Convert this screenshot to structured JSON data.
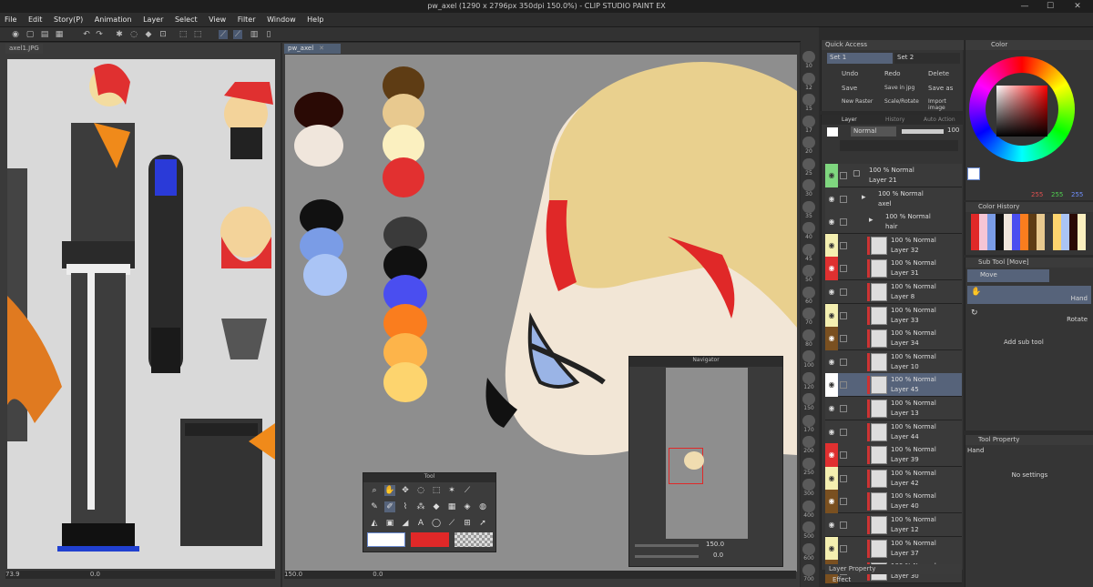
{
  "window": {
    "title": "pw_axel (1290 x 2796px 350dpi 150.0%) - CLIP STUDIO PAINT EX",
    "min": "—",
    "max": "☐",
    "close": "✕"
  },
  "menu": [
    "File",
    "Edit",
    "Story(P)",
    "Animation",
    "Layer",
    "Select",
    "View",
    "Filter",
    "Window",
    "Help"
  ],
  "left_doc": {
    "tab": "axel1.JPG",
    "zoom": "73.9",
    "rotation": "0.0"
  },
  "main_doc": {
    "tab": "pw_axel",
    "zoom": "150.0",
    "rotation": "0.0"
  },
  "navigator": {
    "title": "Navigator",
    "zoom": "150.0",
    "rotation": "0.0"
  },
  "tool_panel": {
    "title": "Tool"
  },
  "palette_levels": [
    "10",
    "12",
    "15",
    "17",
    "20",
    "25",
    "30",
    "35",
    "40",
    "45",
    "50",
    "60",
    "70",
    "80",
    "100",
    "120",
    "150",
    "170",
    "200",
    "250",
    "300",
    "400",
    "500",
    "600",
    "700"
  ],
  "quick_access": {
    "title": "Quick Access",
    "set1": "Set 1",
    "set2": "Set 2",
    "buttons": [
      "Undo",
      "Redo",
      "Delete",
      "Save",
      "Save in jpg",
      "Save as",
      "New Raster",
      "Scale/Rotate",
      "Import image"
    ]
  },
  "layer_panel": {
    "tabs": [
      "Layer",
      "History",
      "Auto Action"
    ],
    "blend_mode": "Normal",
    "opacity": "100",
    "layers": [
      {
        "pct": "100 % Normal",
        "name": "Layer 21",
        "color": "#7fd67f"
      },
      {
        "pct": "100 % Normal",
        "name": "axel",
        "color": ""
      },
      {
        "pct": "100 % Normal",
        "name": "hair",
        "color": ""
      },
      {
        "pct": "100 % Normal",
        "name": "Layer 32",
        "color": "#f4efb0"
      },
      {
        "pct": "100 % Normal",
        "name": "Layer 31",
        "color": "#e03030"
      },
      {
        "pct": "100 % Normal",
        "name": "Layer 8",
        "color": ""
      },
      {
        "pct": "100 % Normal",
        "name": "Layer 33",
        "color": "#f4efb0"
      },
      {
        "pct": "100 % Normal",
        "name": "Layer 34",
        "color": "#7a5020"
      },
      {
        "pct": "100 % Normal",
        "name": "Layer 10",
        "color": ""
      },
      {
        "pct": "100 % Normal",
        "name": "Layer 45",
        "color": "#ffffff"
      },
      {
        "pct": "100 % Normal",
        "name": "Layer 13",
        "color": ""
      },
      {
        "pct": "100 % Normal",
        "name": "Layer 44",
        "color": ""
      },
      {
        "pct": "100 % Normal",
        "name": "Layer 39",
        "color": "#e03030"
      },
      {
        "pct": "100 % Normal",
        "name": "Layer 42",
        "color": "#f4efb0"
      },
      {
        "pct": "100 % Normal",
        "name": "Layer 40",
        "color": "#7a5020"
      },
      {
        "pct": "100 % Normal",
        "name": "Layer 12",
        "color": ""
      },
      {
        "pct": "100 % Normal",
        "name": "Layer 37",
        "color": "#f4efb0"
      },
      {
        "pct": "100 % Normal",
        "name": "Layer 30",
        "color": "#7a5020"
      }
    ]
  },
  "layer_property": {
    "title": "Layer Property",
    "effect": "Effect"
  },
  "color_panel": {
    "title": "Color",
    "r": "255",
    "g": "255",
    "b": "255",
    "history_title": "Color History"
  },
  "subtool": {
    "title": "Sub Tool [Move]",
    "group": "Move",
    "items": [
      "Hand",
      "Rotate"
    ],
    "add": "Add sub tool"
  },
  "tool_property": {
    "title": "Tool Property",
    "tool": "Hand",
    "empty": "No settings"
  },
  "swatches": {
    "col1": [
      "#2a0a05",
      "#f0e6dc"
    ],
    "col2": [
      "#5e3c14",
      "#e8c98f",
      "#fbf0c0",
      "#e23030"
    ],
    "col3": [
      "#111111",
      "#7a9ce6",
      "#aac4f5"
    ],
    "col4": [
      "#3a3a3a",
      "#111111",
      "#4a4ef0",
      "#fa7d1e",
      "#fdb44a",
      "#fdd46e"
    ]
  },
  "colors": {
    "accent": "#56637a",
    "canvas_bg": "#8e8e8e",
    "main_color": "#ffffff",
    "sub_color": "#e02828"
  }
}
